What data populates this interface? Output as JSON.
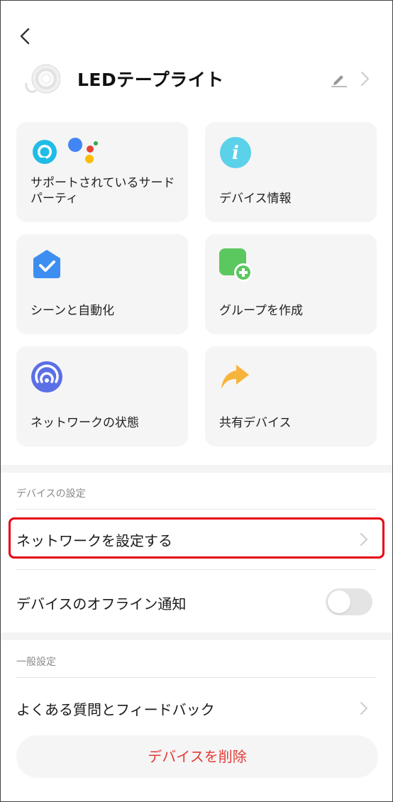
{
  "header": {
    "title": "LEDテープライト"
  },
  "grid": {
    "cards": [
      {
        "label": "サポートされているサードパーティ",
        "icon": "alexa-google-assistant-icon"
      },
      {
        "label": "デバイス情報",
        "icon": "info-icon"
      },
      {
        "label": "シーンと自動化",
        "icon": "scene-check-icon"
      },
      {
        "label": "グループを作成",
        "icon": "group-add-icon"
      },
      {
        "label": "ネットワークの状態",
        "icon": "network-signal-icon"
      },
      {
        "label": "共有デバイス",
        "icon": "share-arrow-icon"
      }
    ]
  },
  "device_settings": {
    "section_label": "デバイスの設定",
    "network_setup": "ネットワークを設定する",
    "offline_notify": "デバイスのオフライン通知",
    "offline_notify_on": false
  },
  "general": {
    "section_label": "一般設定",
    "faq": "よくある質問とフィードバック"
  },
  "delete_button": "デバイスを削除",
  "colors": {
    "highlight": "#e60012",
    "delete_text": "#e53935",
    "card_bg": "#f5f5f5"
  }
}
